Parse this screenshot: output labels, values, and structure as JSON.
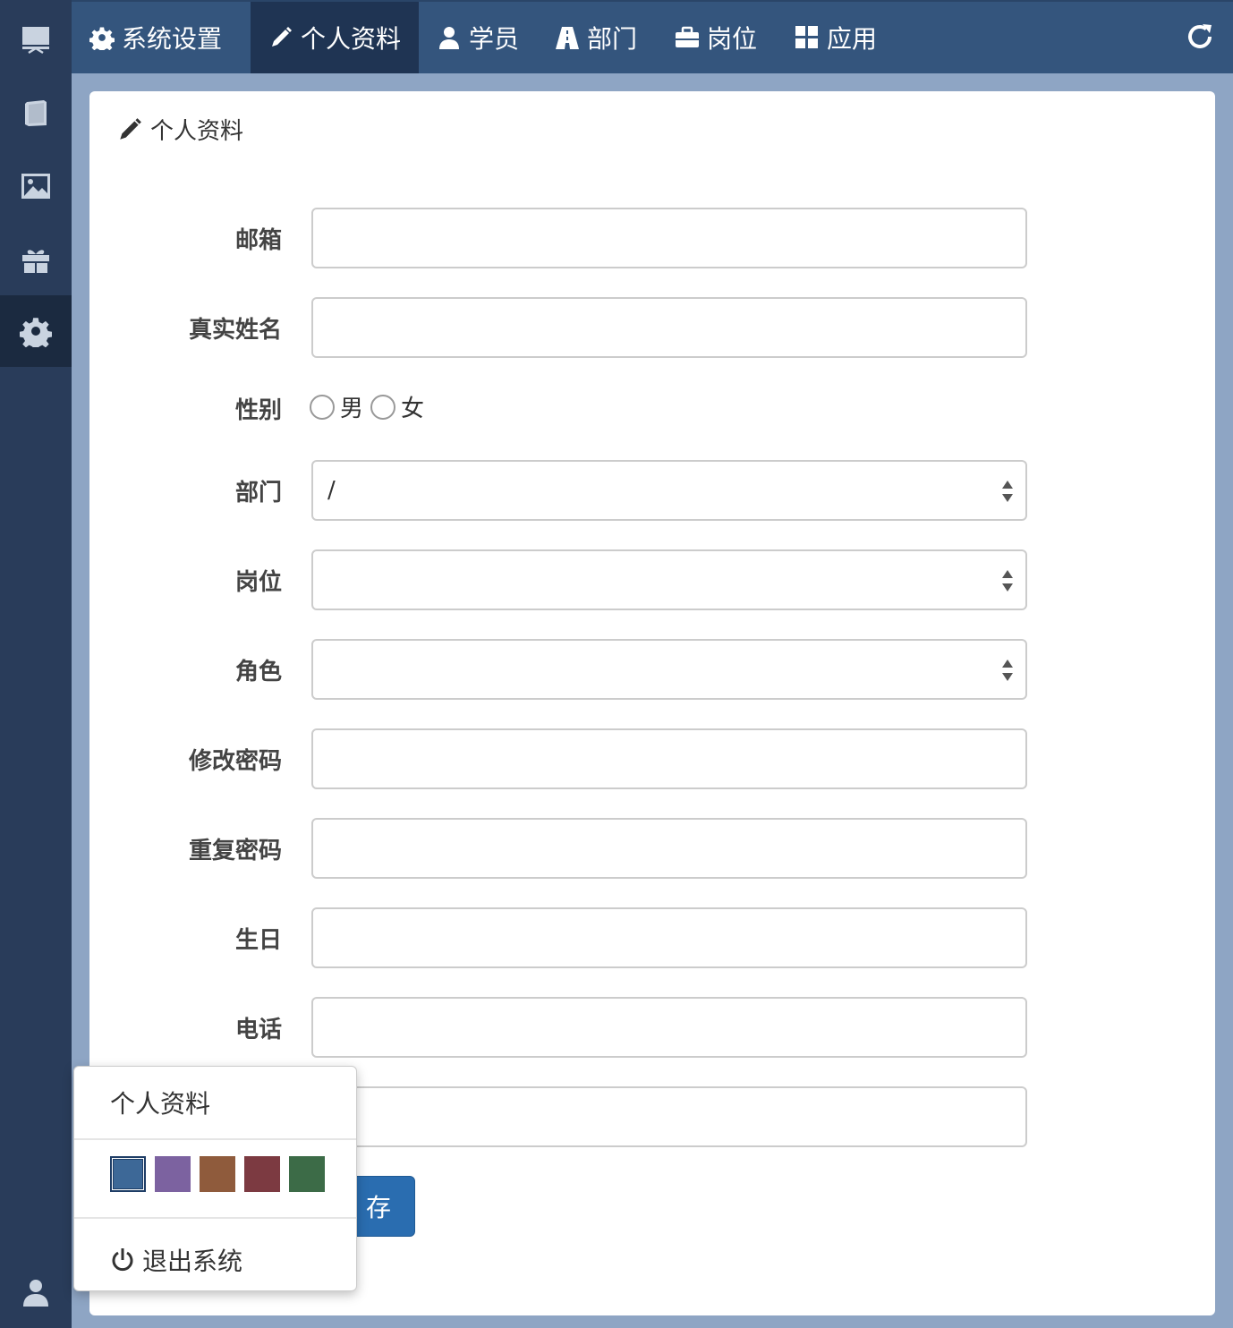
{
  "sidebar": {
    "items": [
      {
        "icon": "desktop-icon"
      },
      {
        "icon": "book-icon"
      },
      {
        "icon": "picture-icon"
      },
      {
        "icon": "gift-icon"
      },
      {
        "icon": "gear-icon",
        "active": true
      }
    ],
    "user_icon": "user-icon"
  },
  "topbar": {
    "tabs": [
      {
        "label": "系统设置",
        "icon": "gear-icon"
      },
      {
        "label": "个人资料",
        "icon": "pencil-icon",
        "active": true
      },
      {
        "label": "学员",
        "icon": "user-icon"
      },
      {
        "label": "部门",
        "icon": "road-icon"
      },
      {
        "label": "岗位",
        "icon": "briefcase-icon"
      },
      {
        "label": "应用",
        "icon": "grid-icon"
      }
    ],
    "refresh_icon": "refresh-icon"
  },
  "panel": {
    "title": "个人资料"
  },
  "form": {
    "email_label": "邮箱",
    "email_value": "",
    "realname_label": "真实姓名",
    "realname_value": "",
    "gender_label": "性别",
    "gender_male": "男",
    "gender_female": "女",
    "dept_label": "部门",
    "dept_value": "/",
    "position_label": "岗位",
    "position_value": "",
    "role_label": "角色",
    "role_value": "",
    "password_label": "修改密码",
    "password_value": "",
    "repeat_label": "重复密码",
    "repeat_value": "",
    "birthday_label": "生日",
    "birthday_value": "",
    "phone_label": "电话",
    "phone_value": "",
    "save_label": "保 存",
    "save_visible": "存"
  },
  "dropdown": {
    "profile_label": "个人资料",
    "logout_label": "退出系统",
    "swatches": [
      "#3d6897",
      "#7c62a0",
      "#8f5b3c",
      "#7c3a41",
      "#3c6b47"
    ],
    "selected_swatch": 0
  },
  "colors": {
    "sidebar_bg": "#293c5a",
    "topbar_bg": "#34557d",
    "active_tab_bg": "#1f3453",
    "page_bg": "#8ea5c4",
    "primary_button": "#2a6db0"
  }
}
